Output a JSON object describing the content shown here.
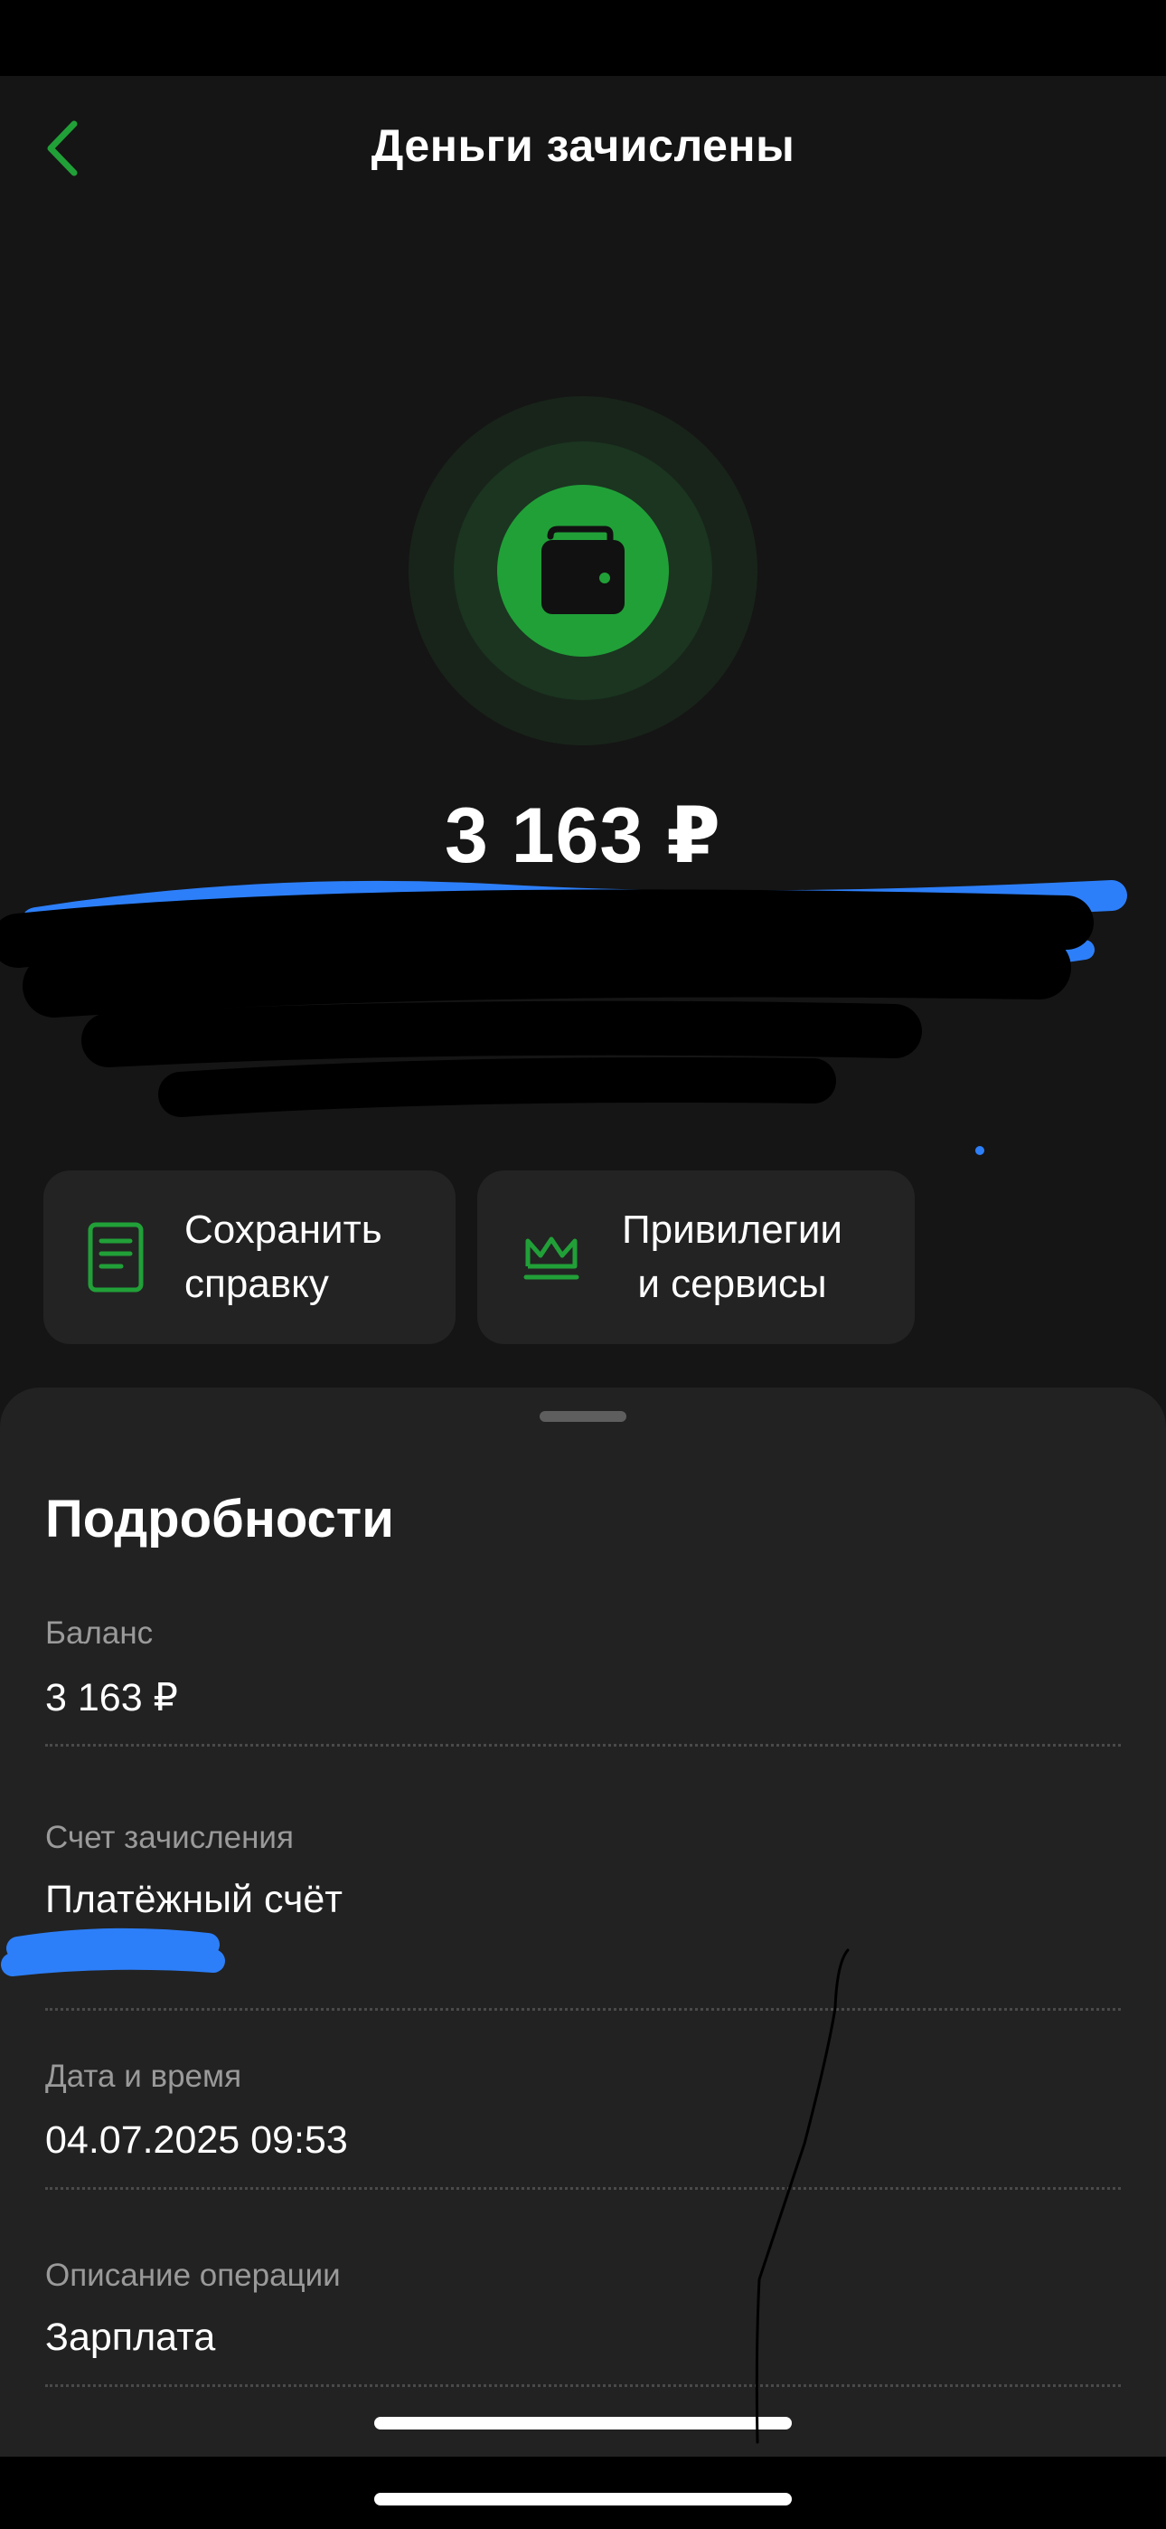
{
  "header": {
    "title": "Деньги зачислены",
    "back_icon": "chevron-left-icon"
  },
  "hero": {
    "icon": "wallet-icon",
    "amount": "3 163 ₽"
  },
  "actions": [
    {
      "label": "Сохранить\nсправку",
      "icon": "document-icon"
    },
    {
      "label": "Привилегии\nи сервисы",
      "icon": "crown-icon"
    }
  ],
  "details": {
    "title": "Подробности",
    "fields": [
      {
        "label": "Баланс",
        "value": "3 163 ₽"
      },
      {
        "label": "Счет зачисления",
        "value": "Платёжный счёт"
      },
      {
        "label": "Дата и время",
        "value": "04.07.2025 09:53"
      },
      {
        "label": "Описание операции",
        "value": "Зарплата"
      }
    ]
  },
  "colors": {
    "accent": "#21a038",
    "background": "#151515",
    "card": "#232323",
    "sheet": "#222222",
    "muted_text": "#9a9a9a"
  }
}
